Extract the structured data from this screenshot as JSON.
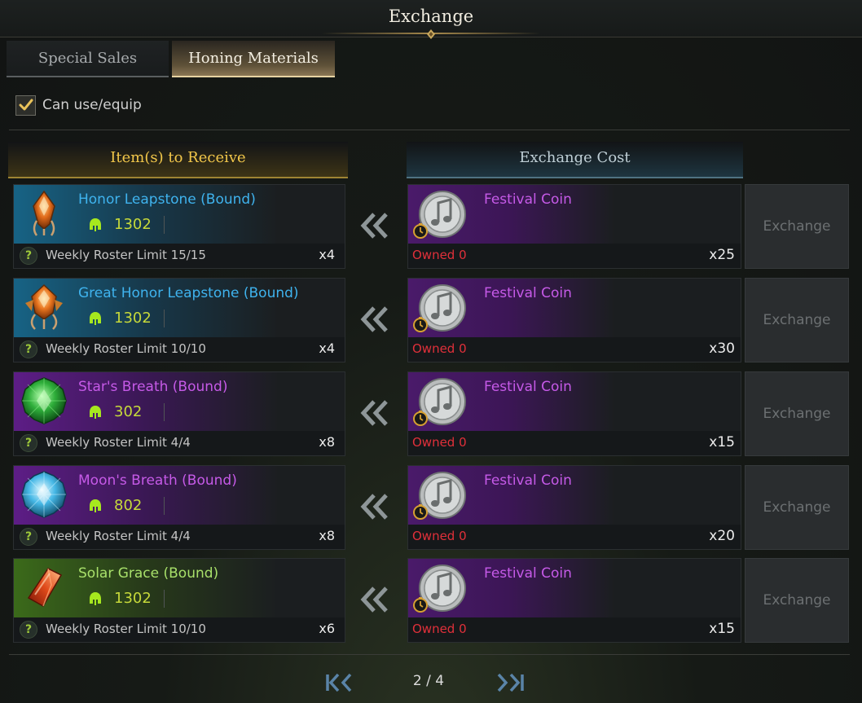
{
  "window": {
    "title": "Exchange"
  },
  "tabs": [
    {
      "label": "Special Sales",
      "active": false
    },
    {
      "label": "Honing Materials",
      "active": true
    }
  ],
  "filter": {
    "label": "Can use/equip",
    "checked": true
  },
  "columns": {
    "receive": "Item(s) to Receive",
    "cost": "Exchange Cost"
  },
  "rows": [
    {
      "name": "Honor Leapstone (Bound)",
      "grade": "blue",
      "icon": "honor-leapstone-icon",
      "level": "1302",
      "limit": "Weekly Roster Limit 15/15",
      "qty": "x4",
      "cost_name": "Festival Coin",
      "owned": "Owned 0",
      "cost_qty": "x25",
      "button": "Exchange"
    },
    {
      "name": "Great Honor Leapstone (Bound)",
      "grade": "blue",
      "icon": "great-honor-leapstone-icon",
      "level": "1302",
      "limit": "Weekly Roster Limit 10/10",
      "qty": "x4",
      "cost_name": "Festival Coin",
      "owned": "Owned 0",
      "cost_qty": "x30",
      "button": "Exchange"
    },
    {
      "name": "Star's Breath (Bound)",
      "grade": "purple",
      "icon": "stars-breath-icon",
      "level": "302",
      "limit": "Weekly Roster Limit 4/4",
      "qty": "x8",
      "cost_name": "Festival Coin",
      "owned": "Owned 0",
      "cost_qty": "x15",
      "button": "Exchange"
    },
    {
      "name": "Moon's Breath (Bound)",
      "grade": "purple",
      "icon": "moons-breath-icon",
      "level": "802",
      "limit": "Weekly Roster Limit 4/4",
      "qty": "x8",
      "cost_name": "Festival Coin",
      "owned": "Owned 0",
      "cost_qty": "x20",
      "button": "Exchange"
    },
    {
      "name": "Solar Grace (Bound)",
      "grade": "green",
      "icon": "solar-grace-icon",
      "level": "1302",
      "limit": "Weekly Roster Limit 10/10",
      "qty": "x6",
      "cost_name": "Festival Coin",
      "owned": "Owned 0",
      "cost_qty": "x15",
      "button": "Exchange"
    }
  ],
  "pager": {
    "text": "2 / 4",
    "current": 2,
    "total": 4
  },
  "colors": {
    "gold": "#f2c74a",
    "blue_grade": "#3fb3ee",
    "purple_grade": "#c65ae8",
    "green_grade": "#a8e06a",
    "owned_red": "#e0303a",
    "level_yellow": "#c6d93a"
  }
}
